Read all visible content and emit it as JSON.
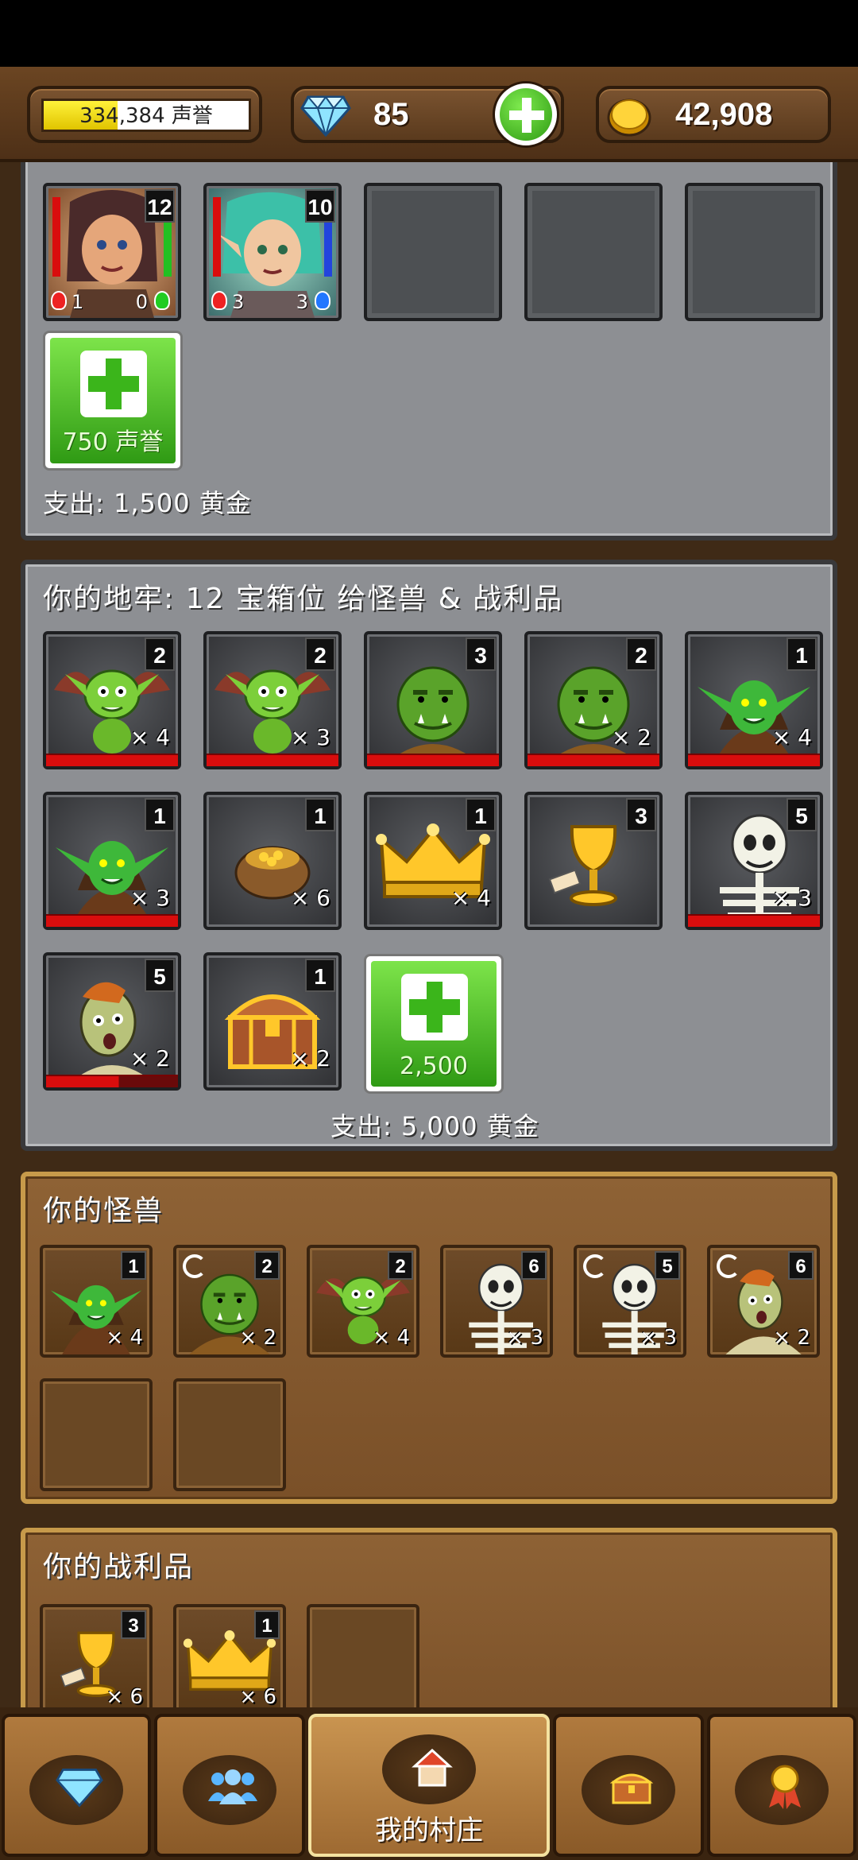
{
  "currency": {
    "reputation_value": 0.36,
    "reputation_text": "334,384 声誉",
    "gems": "85",
    "gold": "42,908"
  },
  "heroes_section": {
    "heroes": [
      {
        "level": "12",
        "red_potions": "1",
        "green_potions": "0"
      },
      {
        "level": "10",
        "red_potions": "3",
        "blue_potions": "3"
      }
    ],
    "add_label": "750 声誉",
    "cost": "支出: 1,500 黄金"
  },
  "dungeon": {
    "title": "你的地牢: 12 宝箱位 给怪兽 & 战利品",
    "slots": [
      {
        "name": "winged-goblin",
        "level": "2",
        "count": "× 4",
        "hp": true
      },
      {
        "name": "winged-goblin",
        "level": "2",
        "count": "× 3",
        "hp": true
      },
      {
        "name": "orc",
        "level": "3",
        "count": "",
        "hp": true
      },
      {
        "name": "orc",
        "level": "2",
        "count": "× 2",
        "hp": true
      },
      {
        "name": "hooded-goblin",
        "level": "1",
        "count": "× 4",
        "hp": true
      },
      {
        "name": "hooded-goblin",
        "level": "1",
        "count": "× 3",
        "hp": true
      },
      {
        "name": "gold-sack",
        "level": "1",
        "count": "× 6",
        "hp": false
      },
      {
        "name": "crown",
        "level": "1",
        "count": "× 4",
        "hp": false
      },
      {
        "name": "chalice",
        "level": "3",
        "count": "",
        "hp": false
      },
      {
        "name": "skeleton",
        "level": "5",
        "count": "× 3",
        "hp": true
      },
      {
        "name": "zombie",
        "level": "5",
        "count": "× 2",
        "hp": true
      },
      {
        "name": "treasure-chest",
        "level": "1",
        "count": "× 2",
        "hp": false
      }
    ],
    "add_label": "2,500",
    "cost": "支出: 5,000 黄金"
  },
  "monsters": {
    "title": "你的怪兽",
    "items": [
      {
        "name": "hooded-goblin",
        "level": "1",
        "count": "× 4"
      },
      {
        "name": "orc",
        "level": "2",
        "count": "× 2"
      },
      {
        "name": "winged-goblin",
        "level": "2",
        "count": "× 4"
      },
      {
        "name": "skeleton",
        "level": "6",
        "count": "× 3"
      },
      {
        "name": "skeleton",
        "level": "5",
        "count": "× 3"
      },
      {
        "name": "zombie",
        "level": "6",
        "count": "× 2"
      }
    ]
  },
  "loot": {
    "title": "你的战利品",
    "items": [
      {
        "name": "chalice",
        "level": "3",
        "count": "× 6"
      },
      {
        "name": "crown",
        "level": "1",
        "count": "× 6"
      }
    ]
  },
  "nav": {
    "tabs": [
      {
        "icon": "gem-icon",
        "label": ""
      },
      {
        "icon": "people-icon",
        "label": ""
      },
      {
        "icon": "house-icon",
        "label": "我的村庄"
      },
      {
        "icon": "chest-icon",
        "label": ""
      },
      {
        "icon": "medal-icon",
        "label": ""
      }
    ]
  },
  "colors": {
    "hp_red": "#d90d0d",
    "add_green": "#3bb51b",
    "wood": "#8e6235",
    "stone": "#8d8f93"
  }
}
